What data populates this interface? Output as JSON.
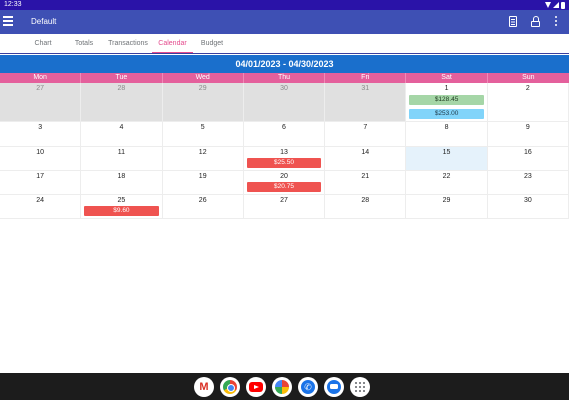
{
  "status_bar": {
    "time": "12:33"
  },
  "app_bar": {
    "title": "Default"
  },
  "tabs": [
    {
      "label": "Chart"
    },
    {
      "label": "Totals"
    },
    {
      "label": "Transactions"
    },
    {
      "label": "Calendar"
    },
    {
      "label": "Budget"
    }
  ],
  "active_tab": "Calendar",
  "calendar": {
    "range_label": "04/01/2023 - 04/30/2023",
    "weekdays": [
      "Mon",
      "Tue",
      "Wed",
      "Thu",
      "Fri",
      "Sat",
      "Sun"
    ],
    "weeks": [
      [
        "27",
        "28",
        "29",
        "30",
        "31",
        "1",
        "2"
      ],
      [
        "3",
        "4",
        "5",
        "6",
        "7",
        "8",
        "9"
      ],
      [
        "10",
        "11",
        "12",
        "13",
        "14",
        "15",
        "16"
      ],
      [
        "17",
        "18",
        "19",
        "20",
        "21",
        "22",
        "23"
      ],
      [
        "24",
        "25",
        "26",
        "27",
        "28",
        "29",
        "30"
      ]
    ],
    "selected_day": "15",
    "events": {
      "sat_1_income": "$128.45",
      "sat_1_info": "$253.00",
      "thu_13": "$25.50",
      "thu_20": "$20.75",
      "tue_25": "$9.60"
    }
  },
  "colors": {
    "status_bar": "#2a13a8",
    "app_bar": "#3e50b4",
    "accent": "#e44b8d",
    "date_range_bar": "#1a6fcc",
    "weekday_header": "#e4609c",
    "income_chip": "#a5d6a7",
    "info_chip": "#81d4fa",
    "expense_chip": "#ef5350",
    "selected_day": "#e5f2fb",
    "other_month": "#e0e0e0"
  },
  "dock_apps": [
    "gmail-icon",
    "chrome-icon",
    "youtube-icon",
    "photos-icon",
    "phone-icon",
    "messages-icon",
    "app-drawer-icon"
  ]
}
